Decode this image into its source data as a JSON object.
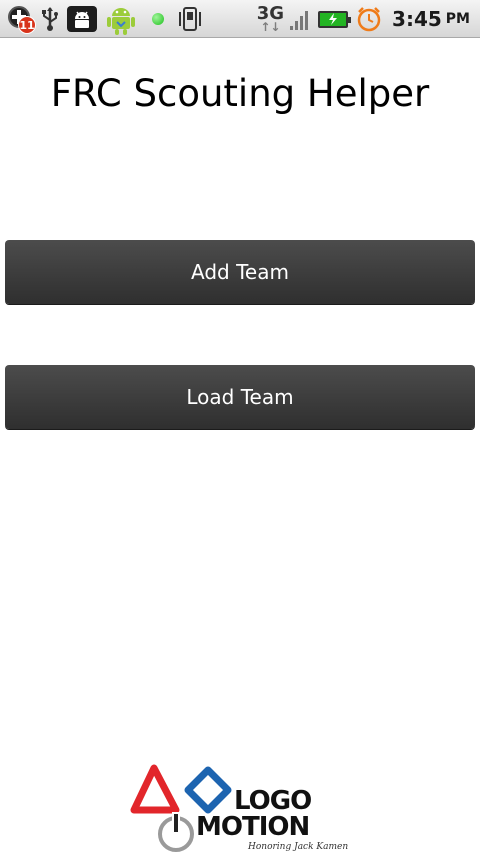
{
  "status_bar": {
    "notification_count": "11",
    "network_type": "3G",
    "network_activity": "↑↓",
    "time": "3:45",
    "ampm": "PM",
    "icons": [
      "calendar-icon",
      "usb-icon",
      "android-debug-icon",
      "android-robot-icon",
      "green-dot-icon",
      "phone-vibrate-icon",
      "network-3g-icon",
      "signal-icon",
      "battery-charging-icon",
      "alarm-icon"
    ]
  },
  "app": {
    "title": "FRC Scouting Helper"
  },
  "buttons": {
    "add_team": "Add Team",
    "load_team": "Load Team"
  },
  "logo": {
    "line1": "LOGO",
    "line2": "MOTION",
    "tagline": "Honoring Jack Kamen"
  },
  "colors": {
    "button_bg": "#3b3b3b",
    "button_text": "#ffffff",
    "background": "#ffffff",
    "logo_red": "#e2262b",
    "logo_blue": "#1d64b0"
  }
}
